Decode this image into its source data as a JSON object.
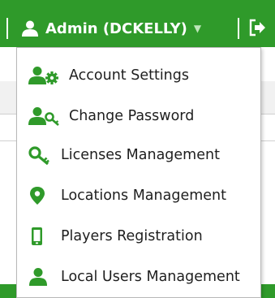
{
  "header": {
    "user_label": "Admin (DCKELLY)",
    "brand_color": "#2f9a2a"
  },
  "menu": {
    "items": [
      {
        "label": "Account Settings",
        "icon": "user-gear-icon"
      },
      {
        "label": "Change Password",
        "icon": "user-key-icon"
      },
      {
        "label": "Licenses Management",
        "icon": "key-icon"
      },
      {
        "label": "Locations Management",
        "icon": "map-marker-icon"
      },
      {
        "label": "Players Registration",
        "icon": "mobile-device-icon"
      },
      {
        "label": "Local Users Management",
        "icon": "user-icon"
      }
    ]
  }
}
